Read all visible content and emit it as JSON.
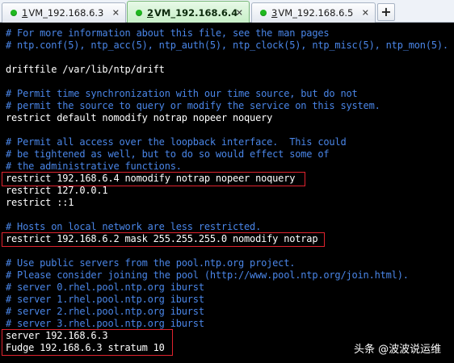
{
  "tabs": [
    {
      "num": "1",
      "label": " VM_192.168.6.3",
      "close": "✕",
      "active": false
    },
    {
      "num": "2",
      "label": " VM_192.168.6.4",
      "close": "✕",
      "active": true
    },
    {
      "num": "3",
      "label": " VM_192.168.6.5",
      "close": "✕",
      "active": false
    }
  ],
  "tab_add_label": "+",
  "colors": {
    "comment": "#4a86e8",
    "text": "#ffffff",
    "highlight": "#e0232e",
    "status_dot": "#1fb81f"
  },
  "lines": [
    {
      "kind": "comment",
      "text": "# For more information about this file, see the man pages"
    },
    {
      "kind": "comment",
      "text": "# ntp.conf(5), ntp_acc(5), ntp_auth(5), ntp_clock(5), ntp_misc(5), ntp_mon(5)."
    },
    {
      "kind": "blank",
      "text": ""
    },
    {
      "kind": "text",
      "text": "driftfile /var/lib/ntp/drift"
    },
    {
      "kind": "blank",
      "text": ""
    },
    {
      "kind": "comment",
      "text": "# Permit time synchronization with our time source, but do not"
    },
    {
      "kind": "comment",
      "text": "# permit the source to query or modify the service on this system."
    },
    {
      "kind": "text",
      "text": "restrict default nomodify notrap nopeer noquery"
    },
    {
      "kind": "blank",
      "text": ""
    },
    {
      "kind": "comment",
      "text": "# Permit all access over the loopback interface.  This could"
    },
    {
      "kind": "comment",
      "text": "# be tightened as well, but to do so would effect some of"
    },
    {
      "kind": "comment",
      "text": "# the administrative functions."
    },
    {
      "kind": "text",
      "text": "restrict 192.168.6.4 nomodify notrap nopeer noquery"
    },
    {
      "kind": "text",
      "text": "restrict 127.0.0.1"
    },
    {
      "kind": "text",
      "text": "restrict ::1"
    },
    {
      "kind": "blank",
      "text": ""
    },
    {
      "kind": "comment",
      "text": "# Hosts on local network are less restricted."
    },
    {
      "kind": "text",
      "text": "restrict 192.168.6.2 mask 255.255.255.0 nomodify notrap"
    },
    {
      "kind": "blank",
      "text": ""
    },
    {
      "kind": "comment",
      "text": "# Use public servers from the pool.ntp.org project."
    },
    {
      "kind": "comment",
      "text": "# Please consider joining the pool (http://www.pool.ntp.org/join.html)."
    },
    {
      "kind": "comment",
      "text": "# server 0.rhel.pool.ntp.org iburst"
    },
    {
      "kind": "comment",
      "text": "# server 1.rhel.pool.ntp.org iburst"
    },
    {
      "kind": "comment",
      "text": "# server 2.rhel.pool.ntp.org iburst"
    },
    {
      "kind": "comment",
      "text": "# server 3.rhel.pool.ntp.org iburst"
    },
    {
      "kind": "text",
      "text": "server 192.168.6.3"
    },
    {
      "kind": "text",
      "text": "Fudge 192.168.6.3 stratum 10"
    }
  ],
  "watermark": "头条 @波波说运维"
}
